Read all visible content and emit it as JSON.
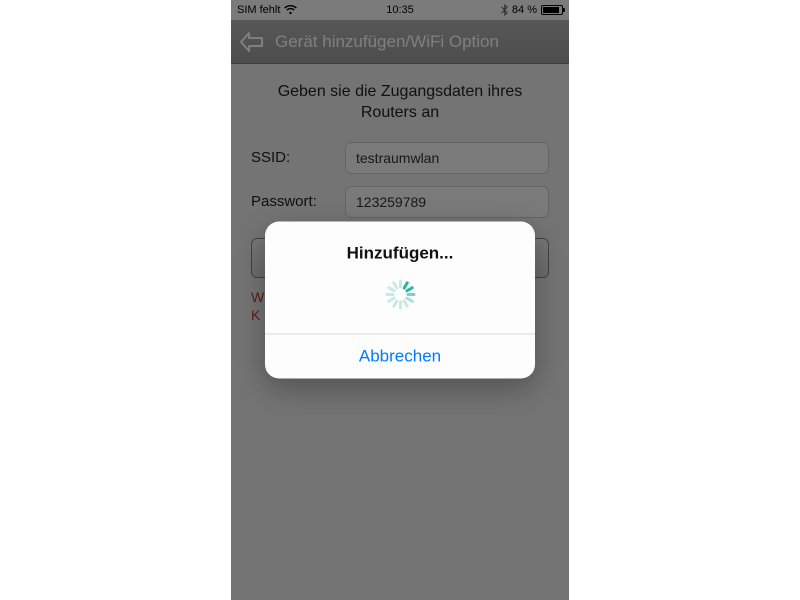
{
  "status": {
    "carrier": "SIM fehlt",
    "time": "10:35",
    "battery_pct": "84 %"
  },
  "nav": {
    "title": "Gerät hinzufügen/WiFi Option"
  },
  "form": {
    "prompt": "Geben sie die Zugangsdaten ihres Routers an",
    "ssid_label": "SSID:",
    "ssid_value": "testraumwlan",
    "pw_label": "Passwort:",
    "pw_value": "123259789"
  },
  "error": {
    "line1": "W",
    "line2": "K"
  },
  "modal": {
    "title": "Hinzufügen...",
    "cancel": "Abbrechen"
  }
}
